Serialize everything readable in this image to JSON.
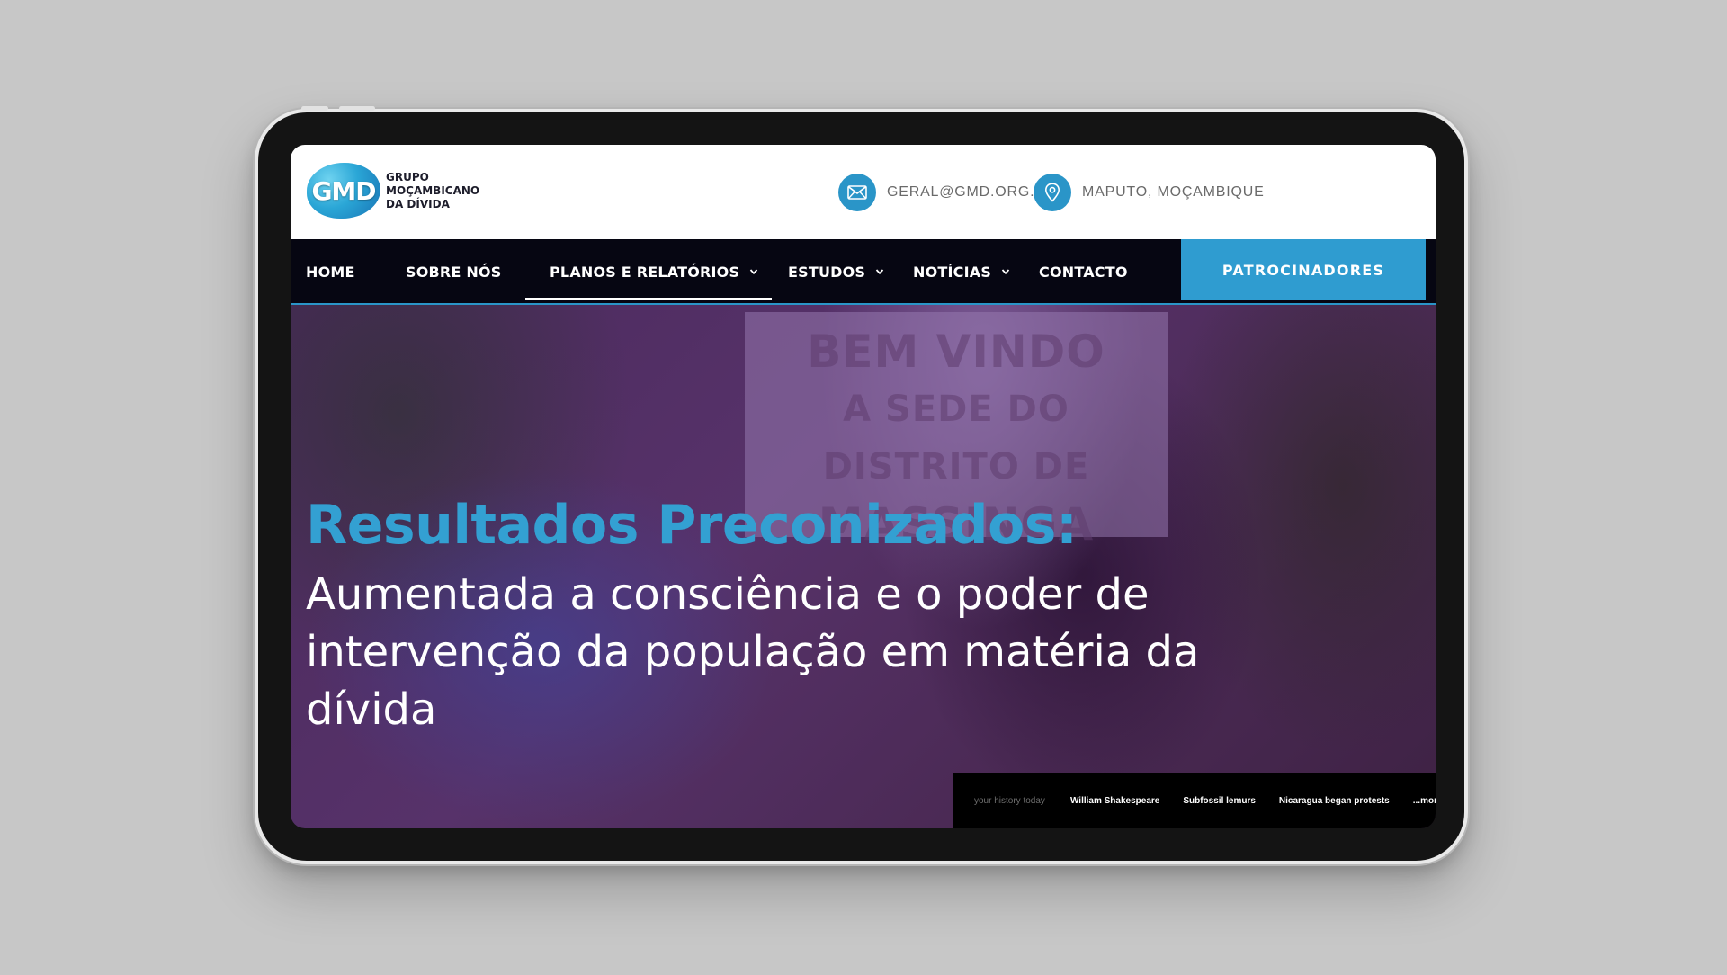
{
  "brand": {
    "logo_mark": "GMD",
    "name_lines": [
      "GRUPO",
      "MOÇAMBICANO",
      "DA DÍVIDA"
    ],
    "accent_color": "#2a95c8"
  },
  "contacts": [
    {
      "icon": "mail-icon",
      "text": "GERAL@GMD.ORG.MZ"
    },
    {
      "icon": "location-pin-icon",
      "text": "MAPUTO, MOÇAMBIQUE"
    }
  ],
  "nav": {
    "items": [
      {
        "label": "HOME",
        "dropdown": false
      },
      {
        "label": "SOBRE NÓS",
        "dropdown": false
      },
      {
        "label": "PLANOS E RELATÓRIOS",
        "dropdown": true,
        "active": true
      },
      {
        "label": "ESTUDOS",
        "dropdown": true
      },
      {
        "label": "NOTÍCIAS",
        "dropdown": true
      },
      {
        "label": "CONTACTO",
        "dropdown": false
      }
    ],
    "cta_label": "PATROCINADORES"
  },
  "hero": {
    "sign_lines": [
      "BEM VINDO",
      "A SEDE DO DISTRITO DE",
      "MASSINGA"
    ],
    "title": "Resultados Preconizados:",
    "subtitle": "Aumentada a consciência e o poder de intervenção da população em matéria da dívida"
  },
  "ticker": {
    "lead": "your history today",
    "items": [
      "William Shakespeare",
      "Subfossil lemurs",
      "Nicaragua began protests",
      "...more"
    ]
  }
}
